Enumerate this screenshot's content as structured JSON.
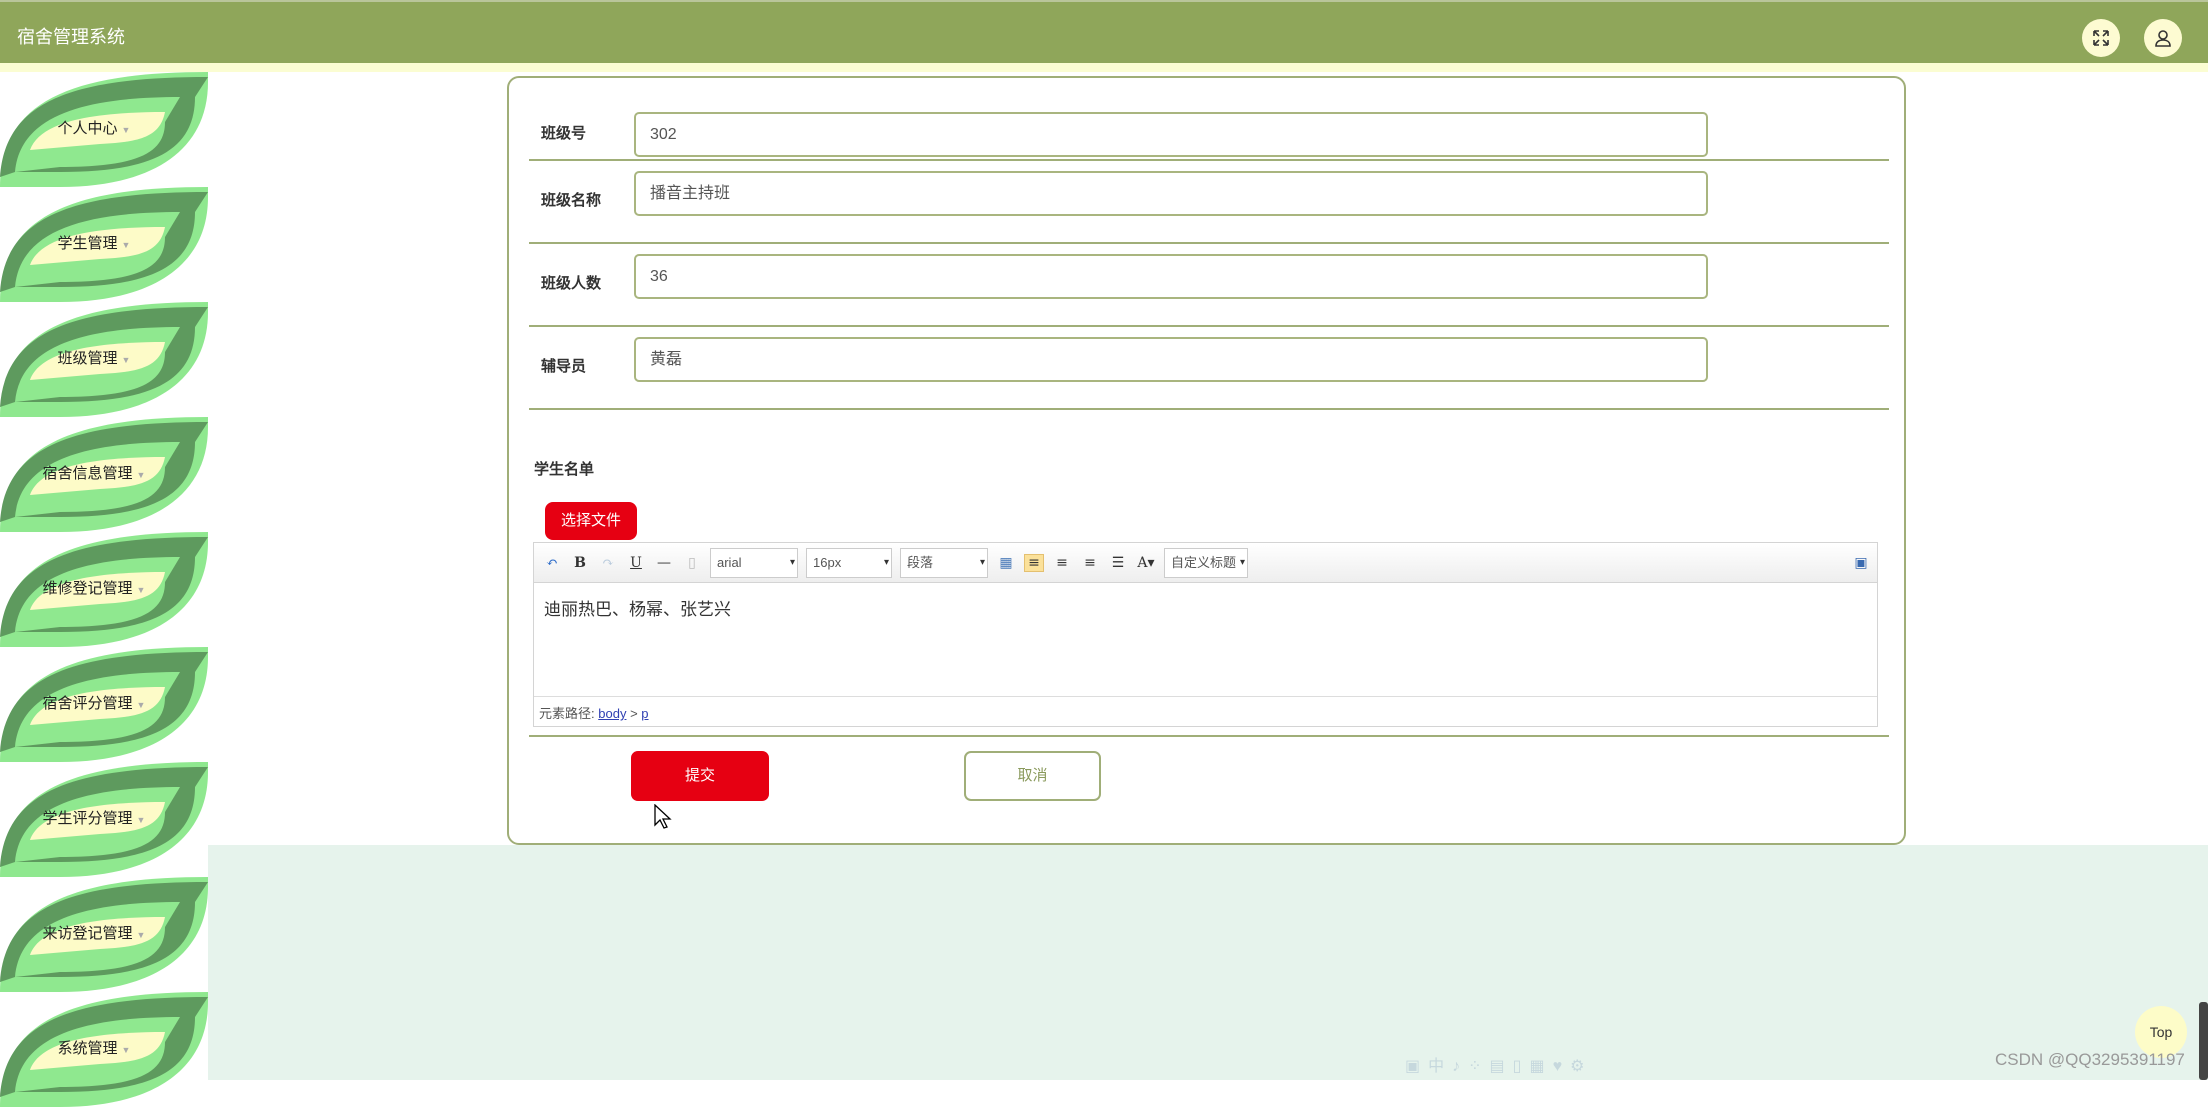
{
  "header": {
    "title": "宿舍管理系统",
    "icons": [
      "fullscreen-icon",
      "user-icon"
    ]
  },
  "sidebar": {
    "items": [
      {
        "label": "个人中心"
      },
      {
        "label": "学生管理"
      },
      {
        "label": "班级管理"
      },
      {
        "label": "宿舍信息管理"
      },
      {
        "label": "维修登记管理"
      },
      {
        "label": "宿舍评分管理"
      },
      {
        "label": "学生评分管理"
      },
      {
        "label": "来访登记管理"
      },
      {
        "label": "系统管理"
      }
    ]
  },
  "form": {
    "fields": [
      {
        "label": "班级号",
        "value": "302"
      },
      {
        "label": "班级名称",
        "value": "播音主持班"
      },
      {
        "label": "班级人数",
        "value": "36"
      },
      {
        "label": "辅导员",
        "value": "黄磊"
      }
    ],
    "student_list_label": "学生名单",
    "file_button": "选择文件",
    "editor": {
      "font": "arial",
      "size": "16px",
      "paragraph": "段落",
      "custom_title": "自定义标题",
      "content": "迪丽热巴、杨幂、张艺兴",
      "path_label": "元素路径:",
      "path_body": "body",
      "path_sep": ">",
      "path_p": "p"
    },
    "submit": "提交",
    "cancel": "取消"
  },
  "top_button": "Top",
  "watermark": "CSDN @QQ3295391197",
  "colors": {
    "header": "#8fa65a",
    "accent_red": "#e60012",
    "leaf_dark": "#5e9a5e",
    "leaf_light": "#8fe88f",
    "pill": "#fdfbc8"
  }
}
